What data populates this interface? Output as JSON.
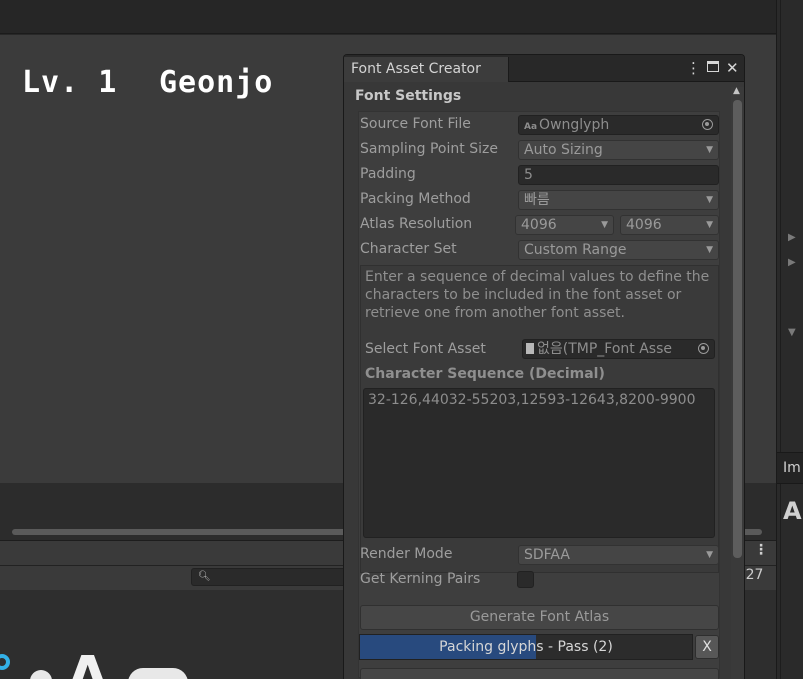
{
  "game_view": {
    "level_text": "Lv. 1",
    "player_name": "Geonjo"
  },
  "background": {
    "right_panel_fragment": "Im",
    "right_panel_letter": "A",
    "status_number_fragment": "›27",
    "kebab": "⋮"
  },
  "font_asset_creator": {
    "tab_title": "Font Asset Creator",
    "controls": {
      "menu": "⋮",
      "close": "✕"
    },
    "section_title": "Font Settings",
    "source_font_file": {
      "label": "Source Font File",
      "value": "Ownglyph",
      "icon": "font-asset-icon"
    },
    "sampling_point_size": {
      "label": "Sampling Point Size",
      "value": "Auto Sizing"
    },
    "padding": {
      "label": "Padding",
      "value": "5"
    },
    "packing_method": {
      "label": "Packing Method",
      "value": "빠름"
    },
    "atlas_resolution": {
      "label": "Atlas Resolution",
      "width": "4096",
      "height": "4096"
    },
    "character_set": {
      "label": "Character Set",
      "value": "Custom Range"
    },
    "help_text": "Enter a sequence of decimal values to define the characters to be included in the font asset or retrieve one from another font asset.",
    "select_font_asset": {
      "label": "Select Font Asset",
      "value": "없음(TMP_Font Asse"
    },
    "character_sequence": {
      "label": "Character Sequence (Decimal)",
      "value": "32-126,44032-55203,12593-12643,8200-9900"
    },
    "render_mode": {
      "label": "Render Mode",
      "value": "SDFAA"
    },
    "get_kerning_pairs": {
      "label": "Get Kerning Pairs",
      "checked": false
    },
    "generate_button": "Generate Font Atlas",
    "progress": {
      "text": "Packing glyphs - Pass (2)",
      "fraction": 0.53
    },
    "cancel_button": "X"
  },
  "colors": {
    "progress_fill": "#284a7e",
    "panel_bg": "#383838",
    "game_view_bg": "#3b3b3b"
  }
}
